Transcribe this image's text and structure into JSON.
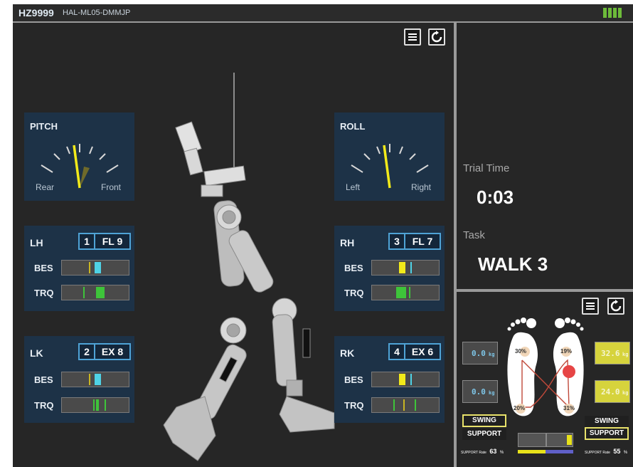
{
  "header": {
    "device_id": "HZ9999",
    "model_id": "HAL-ML05-DMMJP"
  },
  "gauges": {
    "pitch": {
      "title": "PITCH",
      "left_label": "Rear",
      "right_label": "Front"
    },
    "roll": {
      "title": "ROLL",
      "left_label": "Left",
      "right_label": "Right"
    }
  },
  "joints": {
    "lh": {
      "label": "LH",
      "num": "1",
      "mode": "FL 9",
      "bes_label": "BES",
      "trq_label": "TRQ"
    },
    "rh": {
      "label": "RH",
      "num": "3",
      "mode": "FL 7",
      "bes_label": "BES",
      "trq_label": "TRQ"
    },
    "lk": {
      "label": "LK",
      "num": "2",
      "mode": "EX 8",
      "bes_label": "BES",
      "trq_label": "TRQ"
    },
    "rk": {
      "label": "RK",
      "num": "4",
      "mode": "EX 6",
      "bes_label": "BES",
      "trq_label": "TRQ"
    }
  },
  "trial": {
    "time_label": "Trial Time",
    "time_value": "0:03",
    "task_label": "Task",
    "task_value": "WALK 3"
  },
  "feet": {
    "left_heel_pct": "30%",
    "left_toe_pct": "20%",
    "right_heel_pct": "19%",
    "right_toe_pct": "31%",
    "left_kg_top": "0.0",
    "left_kg_bottom": "0.0",
    "right_kg_top": "32.6",
    "right_kg_bottom": "24.0",
    "kg_unit": "kg",
    "left_state_swing": "SWING",
    "left_state_support": "SUPPORT",
    "right_state_swing": "SWING",
    "right_state_support": "SUPPORT",
    "support_rate_label": "SUPPORT Rate",
    "left_support_rate": "63",
    "right_support_rate": "55",
    "pct": "%"
  },
  "colors": {
    "accent_blue": "#4fa3d6",
    "yellow": "#e8e21a",
    "green": "#3ec43a",
    "cyan": "#4fd2e6",
    "red": "#e64545"
  }
}
